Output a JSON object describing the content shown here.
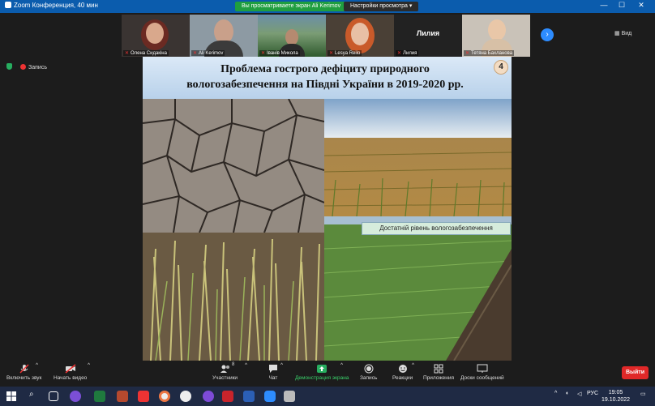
{
  "window": {
    "title": "Zoom Конференция, 40 мин",
    "sharing_banner": "Вы просматриваете экран Ali Kerimov",
    "view_options": "Настройки просмотра",
    "minimize": "—",
    "maximize": "☐",
    "close": "✕"
  },
  "gallery": {
    "view_label": "Вид",
    "next_label": "›",
    "participants": [
      {
        "name": "Олена Сидакіна"
      },
      {
        "name": "Ali Kerimov"
      },
      {
        "name": "Іванів Микола"
      },
      {
        "name": "Lesya Reilo"
      },
      {
        "name": "Лилия",
        "label": "Лилия"
      },
      {
        "name": "Тетяна Бахланова"
      }
    ]
  },
  "recording": {
    "label": "Запись"
  },
  "slide": {
    "title_line1": "Проблема гострого дефіциту природного",
    "title_line2": "вологозабезпечення на Півдні України в 2019-2020 рр.",
    "number": "4",
    "caption": "Достатній рівень вологозабезпечення"
  },
  "toolbar": {
    "unmute": "Включить звук",
    "start_video": "Начать видео",
    "participants": "Участники",
    "participants_count": "8",
    "chat": "Чат",
    "share_screen": "Демонстрация экрана",
    "record": "Запись",
    "reactions": "Реакции",
    "apps": "Приложения",
    "whiteboards": "Доски сообщений",
    "leave": "Выйти"
  },
  "taskbar": {
    "language": "РУС",
    "time": "19:05",
    "date": "19.10.2022"
  },
  "colors": {
    "zoom_blue": "#0b5cad",
    "share_green": "#1f9e3f",
    "leave_red": "#e02828"
  }
}
